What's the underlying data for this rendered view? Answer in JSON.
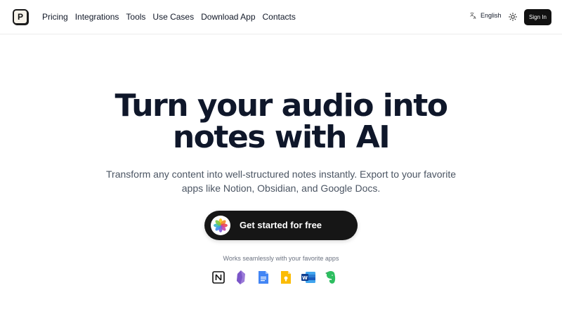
{
  "header": {
    "logo_letter": "P",
    "nav": [
      "Pricing",
      "Integrations",
      "Tools",
      "Use Cases",
      "Download App",
      "Contacts"
    ],
    "language": "English",
    "signin_label": "Sign In"
  },
  "hero": {
    "title_line1": "Turn your audio into",
    "title_line2": "notes with AI",
    "subtitle_line1": "Transform any content into well-structured notes instantly. Export to your favorite",
    "subtitle_line2": "apps like Notion, Obsidian, and Google Docs.",
    "cta_label": "Get started for free",
    "works_text": "Works seamlessly with your favorite apps"
  },
  "apps": [
    "notion-icon",
    "obsidian-icon",
    "google-docs-icon",
    "google-keep-icon",
    "microsoft-word-icon",
    "evernote-icon"
  ],
  "colors": {
    "primary": "#111111",
    "text": "#111827",
    "muted": "#4b5563"
  }
}
